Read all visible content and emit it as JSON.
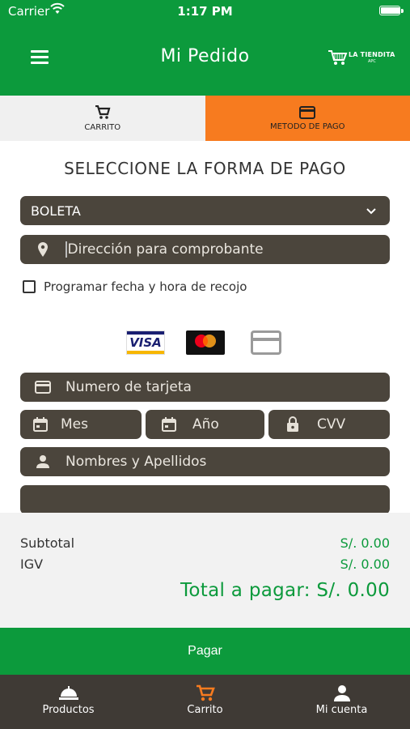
{
  "status_bar": {
    "carrier": "Carrier",
    "time": "1:17 PM",
    "battery_level": 0.95
  },
  "header": {
    "title": "Mi Pedido",
    "logo_text": "LA TIENDITA",
    "logo_sub": "APC",
    "icons": {
      "menu": "hamburger-menu-icon",
      "logo": "shopping-cart-logo"
    }
  },
  "tabs": [
    {
      "label": "CARRITO",
      "icon": "cart-icon",
      "active": false
    },
    {
      "label": "METODO DE PAGO",
      "icon": "credit-card-icon",
      "active": true
    }
  ],
  "form": {
    "section_title": "SELECCIONE LA FORMA DE PAGO",
    "receipt_type": {
      "selected": "BOLETA"
    },
    "address": {
      "placeholder": "Dirección para comprobante",
      "icon": "location-pin-icon"
    },
    "schedule_pickup": {
      "label": "Programar fecha y hora de recojo",
      "checked": false
    },
    "card_brands": [
      {
        "name": "VISA",
        "icon": "visa-icon"
      },
      {
        "name": "mastercard",
        "icon": "mastercard-icon"
      },
      {
        "name": "generic",
        "icon": "generic-card-icon"
      }
    ],
    "card_number": {
      "placeholder": "Numero de tarjeta",
      "icon": "credit-card-icon"
    },
    "month": {
      "placeholder": "Mes",
      "icon": "calendar-icon"
    },
    "year": {
      "placeholder": "Año",
      "icon": "calendar-icon"
    },
    "cvv": {
      "placeholder": "CVV",
      "icon": "lock-icon"
    },
    "names": {
      "placeholder": "Nombres y Apellidos",
      "icon": "person-icon"
    }
  },
  "totals": {
    "subtotal_label": "Subtotal",
    "subtotal_value": "S/. 0.00",
    "igv_label": "IGV",
    "igv_value": "S/. 0.00",
    "total_text": "Total a pagar: S/. 0.00"
  },
  "pay_button": {
    "label": "Pagar"
  },
  "bottom_nav": [
    {
      "label": "Productos",
      "icon": "food-tray-icon",
      "active": false
    },
    {
      "label": "Carrito",
      "icon": "cart-icon",
      "active": true
    },
    {
      "label": "Mi cuenta",
      "icon": "person-icon",
      "active": false
    }
  ],
  "colors": {
    "primary_green": "#0c9a3c",
    "accent_orange": "#f77b1f",
    "field_dark": "#4b453c",
    "nav_dark": "#3f3a35"
  }
}
